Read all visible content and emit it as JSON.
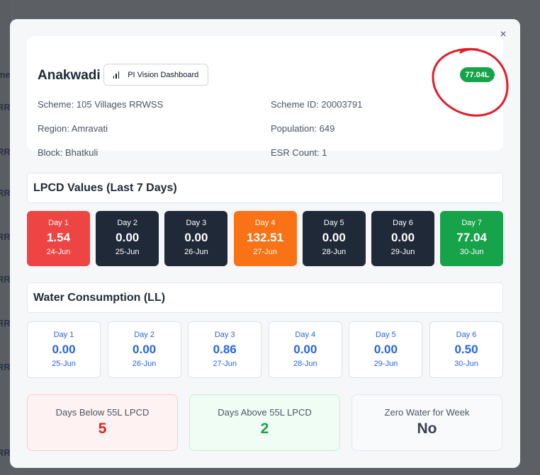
{
  "backdrop": {
    "fragments": [
      "me",
      "RR",
      "RR",
      "RR",
      "RR",
      "RR",
      "RR",
      "RR",
      "RR"
    ]
  },
  "modal": {
    "close_label": "×",
    "village": "Anakwadi",
    "pi_button_label": "PI Vision Dashboard",
    "badge": "77.04L",
    "info": {
      "scheme": "Scheme: 105 Villages RRWSS",
      "scheme_id": "Scheme ID: 20003791",
      "region": "Region: Amravati",
      "population": "Population: 649",
      "block": "Block: Bhatkuli",
      "esr_count": "ESR Count: 1"
    },
    "lpcd": {
      "title": "LPCD Values (Last 7 Days)",
      "days": [
        {
          "day": "Day 1",
          "value": "1.54",
          "date": "24-Jun",
          "color": "#ef4444"
        },
        {
          "day": "Day 2",
          "value": "0.00",
          "date": "25-Jun",
          "color": "#1f2937"
        },
        {
          "day": "Day 3",
          "value": "0.00",
          "date": "26-Jun",
          "color": "#1f2937"
        },
        {
          "day": "Day 4",
          "value": "132.51",
          "date": "27-Jun",
          "color": "#f97316"
        },
        {
          "day": "Day 5",
          "value": "0.00",
          "date": "28-Jun",
          "color": "#1f2937"
        },
        {
          "day": "Day 6",
          "value": "0.00",
          "date": "29-Jun",
          "color": "#1f2937"
        },
        {
          "day": "Day 7",
          "value": "77.04",
          "date": "30-Jun",
          "color": "#16a34a"
        }
      ]
    },
    "water": {
      "title": "Water Consumption (LL)",
      "days": [
        {
          "day": "Day 1",
          "value": "0.00",
          "date": "25-Jun"
        },
        {
          "day": "Day 2",
          "value": "0.00",
          "date": "26-Jun"
        },
        {
          "day": "Day 3",
          "value": "0.86",
          "date": "27-Jun"
        },
        {
          "day": "Day 4",
          "value": "0.00",
          "date": "28-Jun"
        },
        {
          "day": "Day 5",
          "value": "0.00",
          "date": "29-Jun"
        },
        {
          "day": "Day 6",
          "value": "0.50",
          "date": "30-Jun"
        }
      ]
    },
    "summary": {
      "below": {
        "label": "Days Below 55L LPCD",
        "value": "5"
      },
      "above": {
        "label": "Days Above 55L LPCD",
        "value": "2"
      },
      "zero": {
        "label": "Zero Water for Week",
        "value": "No"
      }
    }
  }
}
